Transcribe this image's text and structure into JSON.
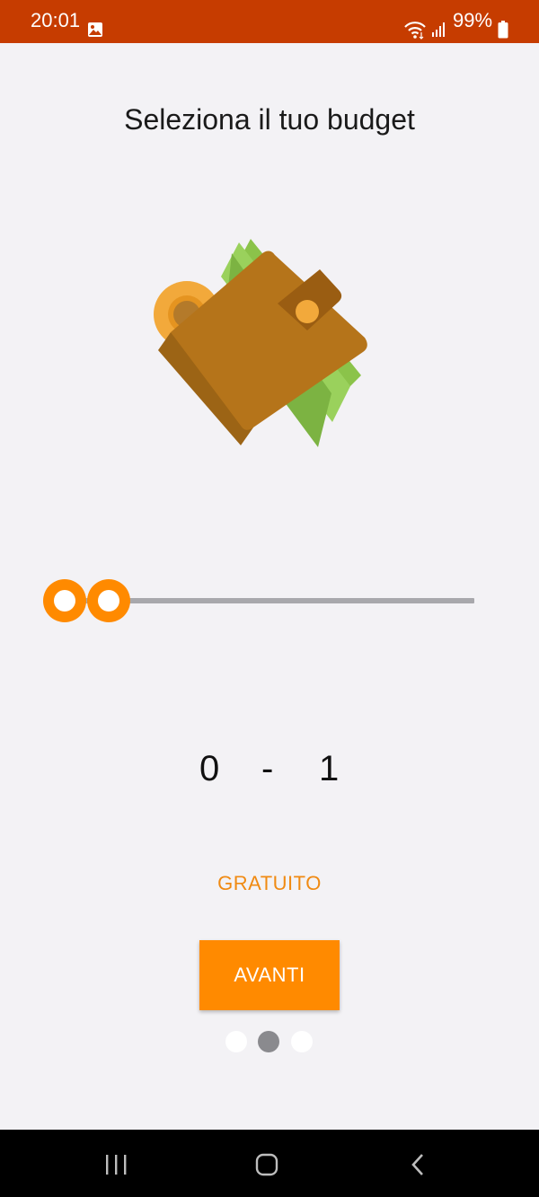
{
  "status_bar": {
    "time": "20:01",
    "battery": "99%",
    "background": "#c63c00"
  },
  "screen": {
    "title": "Seleziona il tuo budget",
    "illustration": "wallet-icon"
  },
  "slider": {
    "min_value": 0,
    "max_value": 1,
    "accent": "#ff8a00"
  },
  "range_display": {
    "min": "0",
    "separator": "-",
    "max": "1"
  },
  "budget_label": "GRATUITO",
  "next_button": {
    "label": "AVANTI"
  },
  "pager": {
    "count": 3,
    "active_index": 1
  },
  "nav_bar": {
    "icons": [
      "recents-icon",
      "home-icon",
      "back-icon"
    ]
  }
}
